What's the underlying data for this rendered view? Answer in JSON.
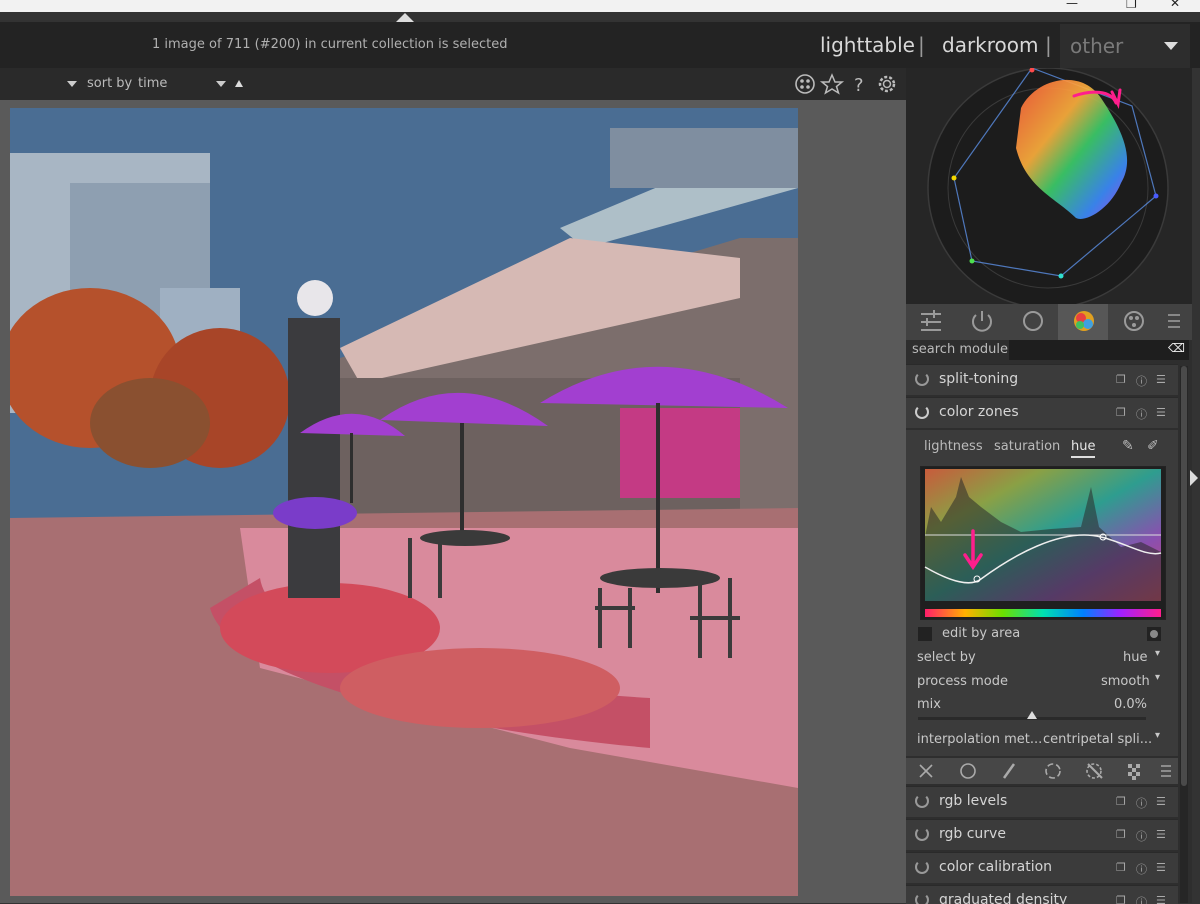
{
  "header": {
    "status": "1 image of 711 (#200) in current collection is selected",
    "views": [
      "lighttable",
      "darkroom",
      "other"
    ],
    "separator": "|"
  },
  "filterbar": {
    "sort_label": "sort by",
    "sort_value": "time",
    "icons": [
      "grouping-icon",
      "star-icon",
      "help-icon",
      "settings-icon"
    ]
  },
  "panel": {
    "search_label": "search module",
    "search_value": "",
    "tab_icons": [
      "sliders-icon",
      "power-icon",
      "circle-icon",
      "color-icon",
      "palette-icon",
      "menu-icon"
    ],
    "modules_top": [
      "split-toning",
      "color zones"
    ],
    "color_zones": {
      "tabs": [
        "lightness",
        "saturation",
        "hue"
      ],
      "active_tab": "hue",
      "edit_by_area": "edit by area",
      "select_by_label": "select by",
      "select_by_value": "hue",
      "process_mode_label": "process mode",
      "process_mode_value": "smooth",
      "mix_label": "mix",
      "mix_value": "0.0%",
      "mix_fraction": 0.5,
      "interp_label": "interpolation met...",
      "interp_value": "centripetal spli..."
    },
    "modules_bottom": [
      "rgb levels",
      "rgb curve",
      "color calibration",
      "graduated density"
    ]
  },
  "colors": {
    "accent_pink": "#ff1e8c",
    "umbrella": "#a23fd0",
    "sky": "#4a6d93"
  }
}
